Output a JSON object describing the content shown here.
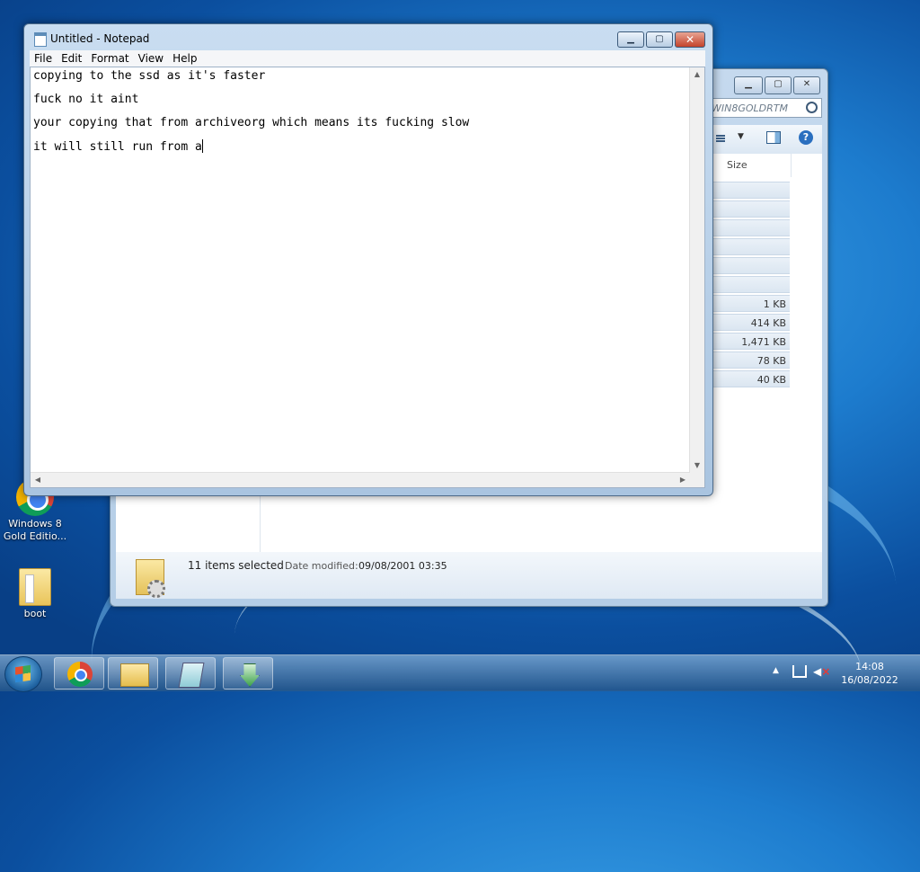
{
  "desktop": {
    "icons": [
      {
        "label": "Windows 8\nGold Editio..."
      },
      {
        "label": "boot"
      }
    ]
  },
  "explorer": {
    "search_placeholder": "WIN8GOLDRTM",
    "column_header": "Size",
    "sizes": [
      "",
      "",
      "",
      "",
      "",
      "",
      "1 KB",
      "414 KB",
      "1,471 KB",
      "78 KB",
      "40 KB"
    ],
    "details": {
      "count": "11 items selected",
      "date_label": "Date modified:",
      "date_value": "09/08/2001 03:35"
    }
  },
  "notepad": {
    "title": "Untitled - Notepad",
    "menu": [
      "File",
      "Edit",
      "Format",
      "View",
      "Help"
    ],
    "lines": [
      "copying to the ssd as it's faster",
      "fuck no it aint",
      "your copying that from archiveorg which means its fucking slow",
      "it will still run from a"
    ]
  },
  "taskbar": {
    "clock_time": "14:08",
    "clock_date": "16/08/2022"
  }
}
